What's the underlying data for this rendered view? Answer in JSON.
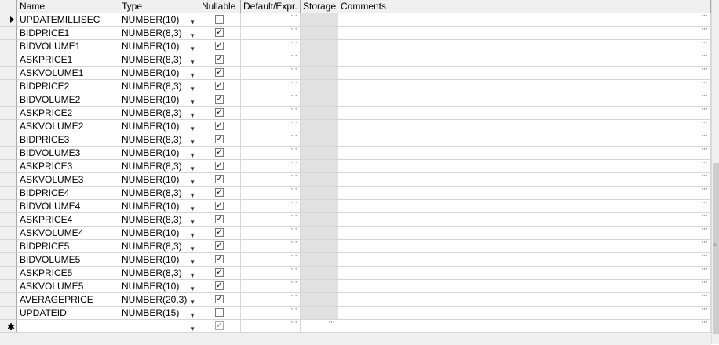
{
  "headers": {
    "name": "Name",
    "type": "Type",
    "nullable": "Nullable",
    "default": "Default/Expr.",
    "storage": "Storage",
    "comments": "Comments"
  },
  "ellipsis": "···",
  "new_row_marker": "✱",
  "columns": [
    {
      "name": "UPDATEMILLISEC",
      "type": "NUMBER(10)",
      "nullable": false
    },
    {
      "name": "BIDPRICE1",
      "type": "NUMBER(8,3)",
      "nullable": true
    },
    {
      "name": "BIDVOLUME1",
      "type": "NUMBER(10)",
      "nullable": true
    },
    {
      "name": "ASKPRICE1",
      "type": "NUMBER(8,3)",
      "nullable": true
    },
    {
      "name": "ASKVOLUME1",
      "type": "NUMBER(10)",
      "nullable": true
    },
    {
      "name": "BIDPRICE2",
      "type": "NUMBER(8,3)",
      "nullable": true
    },
    {
      "name": "BIDVOLUME2",
      "type": "NUMBER(10)",
      "nullable": true
    },
    {
      "name": "ASKPRICE2",
      "type": "NUMBER(8,3)",
      "nullable": true
    },
    {
      "name": "ASKVOLUME2",
      "type": "NUMBER(10)",
      "nullable": true
    },
    {
      "name": "BIDPRICE3",
      "type": "NUMBER(8,3)",
      "nullable": true
    },
    {
      "name": "BIDVOLUME3",
      "type": "NUMBER(10)",
      "nullable": true
    },
    {
      "name": "ASKPRICE3",
      "type": "NUMBER(8,3)",
      "nullable": true
    },
    {
      "name": "ASKVOLUME3",
      "type": "NUMBER(10)",
      "nullable": true
    },
    {
      "name": "BIDPRICE4",
      "type": "NUMBER(8,3)",
      "nullable": true
    },
    {
      "name": "BIDVOLUME4",
      "type": "NUMBER(10)",
      "nullable": true
    },
    {
      "name": "ASKPRICE4",
      "type": "NUMBER(8,3)",
      "nullable": true
    },
    {
      "name": "ASKVOLUME4",
      "type": "NUMBER(10)",
      "nullable": true
    },
    {
      "name": "BIDPRICE5",
      "type": "NUMBER(8,3)",
      "nullable": true
    },
    {
      "name": "BIDVOLUME5",
      "type": "NUMBER(10)",
      "nullable": true
    },
    {
      "name": "ASKPRICE5",
      "type": "NUMBER(8,3)",
      "nullable": true
    },
    {
      "name": "ASKVOLUME5",
      "type": "NUMBER(10)",
      "nullable": true
    },
    {
      "name": "AVERAGEPRICE",
      "type": "NUMBER(20,3)",
      "nullable": true
    },
    {
      "name": "UPDATEID",
      "type": "NUMBER(15)",
      "nullable": false
    }
  ],
  "new_row": {
    "name": "",
    "type": "",
    "nullable": true
  },
  "icons": {
    "dropdown": "dropdown-arrow-icon",
    "ellipsis": "ellipsis-icon",
    "checkbox": "checkbox-icon",
    "current_row": "current-row-indicator-icon",
    "new_row": "new-row-asterisk-icon"
  },
  "colors": {
    "header_bg": "#f0f0f0",
    "storage_bg": "#e1e1e1",
    "grid_line": "#d6d6d6"
  }
}
